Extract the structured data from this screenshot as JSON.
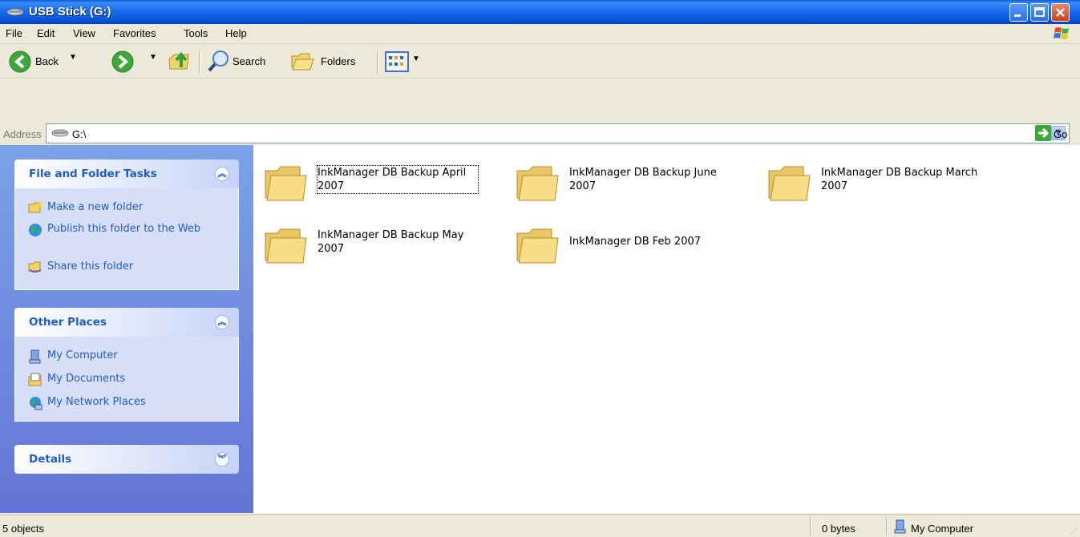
{
  "window": {
    "title": "USB Stick (G:)"
  },
  "menu": [
    "File",
    "Edit",
    "View",
    "Favorites",
    "Tools",
    "Help"
  ],
  "toolbar": {
    "back_label": "Back",
    "search_label": "Search",
    "folders_label": "Folders"
  },
  "address": {
    "label": "Address",
    "value": "G:\\",
    "go_label": "Go"
  },
  "task_pane": {
    "file_tasks": {
      "title": "File and Folder Tasks",
      "items": [
        "Make a new folder",
        "Publish this folder to the Web",
        "Share this folder"
      ]
    },
    "other_places": {
      "title": "Other Places",
      "items": [
        "My Computer",
        "My Documents",
        "My Network Places"
      ]
    },
    "details": {
      "title": "Details"
    }
  },
  "folders": [
    "InkManager DB Backup April 2007",
    "InkManager DB Backup June 2007",
    "InkManager DB Backup March 2007",
    "InkManager DB Backup May 2007",
    "InkManager DB Feb 2007"
  ],
  "status": {
    "objects": "5 objects",
    "size": "0 bytes",
    "zone": "My Computer"
  },
  "colors": {
    "titlebar": "#0753D8",
    "taskpane": "#6375D6",
    "link": "#215DC6",
    "chrome": "#ECE9D8"
  }
}
